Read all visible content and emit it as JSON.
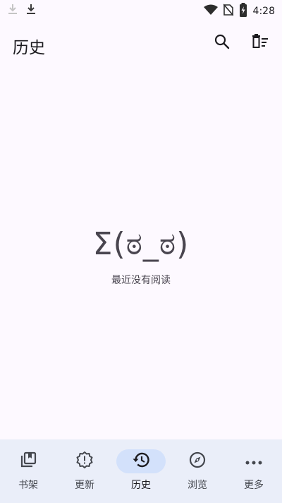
{
  "status_bar": {
    "time": "4:28",
    "icons": [
      "download-dim-icon",
      "download-icon",
      "wifi-icon",
      "no-sim-icon",
      "battery-charging-icon"
    ]
  },
  "app_bar": {
    "title": "历史",
    "actions": [
      "search-icon",
      "delete-history-icon"
    ]
  },
  "empty_state": {
    "kaomoji": "Σ(ಠ_ಠ)",
    "message": "最近没有阅读"
  },
  "bottom_nav": {
    "active": "history",
    "items": [
      {
        "id": "library",
        "label": "书架",
        "icon": "library-icon"
      },
      {
        "id": "updates",
        "label": "更新",
        "icon": "updates-badge-icon"
      },
      {
        "id": "history",
        "label": "历史",
        "icon": "history-icon"
      },
      {
        "id": "browse",
        "label": "浏览",
        "icon": "compass-icon"
      },
      {
        "id": "more",
        "label": "更多",
        "icon": "more-horiz-icon"
      }
    ]
  },
  "colors": {
    "background": "#fdf9ff",
    "nav_background": "#eaeef9",
    "active_indicator": "#d3e1fb",
    "text_primary": "#1c1b1f",
    "text_secondary": "#49454f"
  }
}
